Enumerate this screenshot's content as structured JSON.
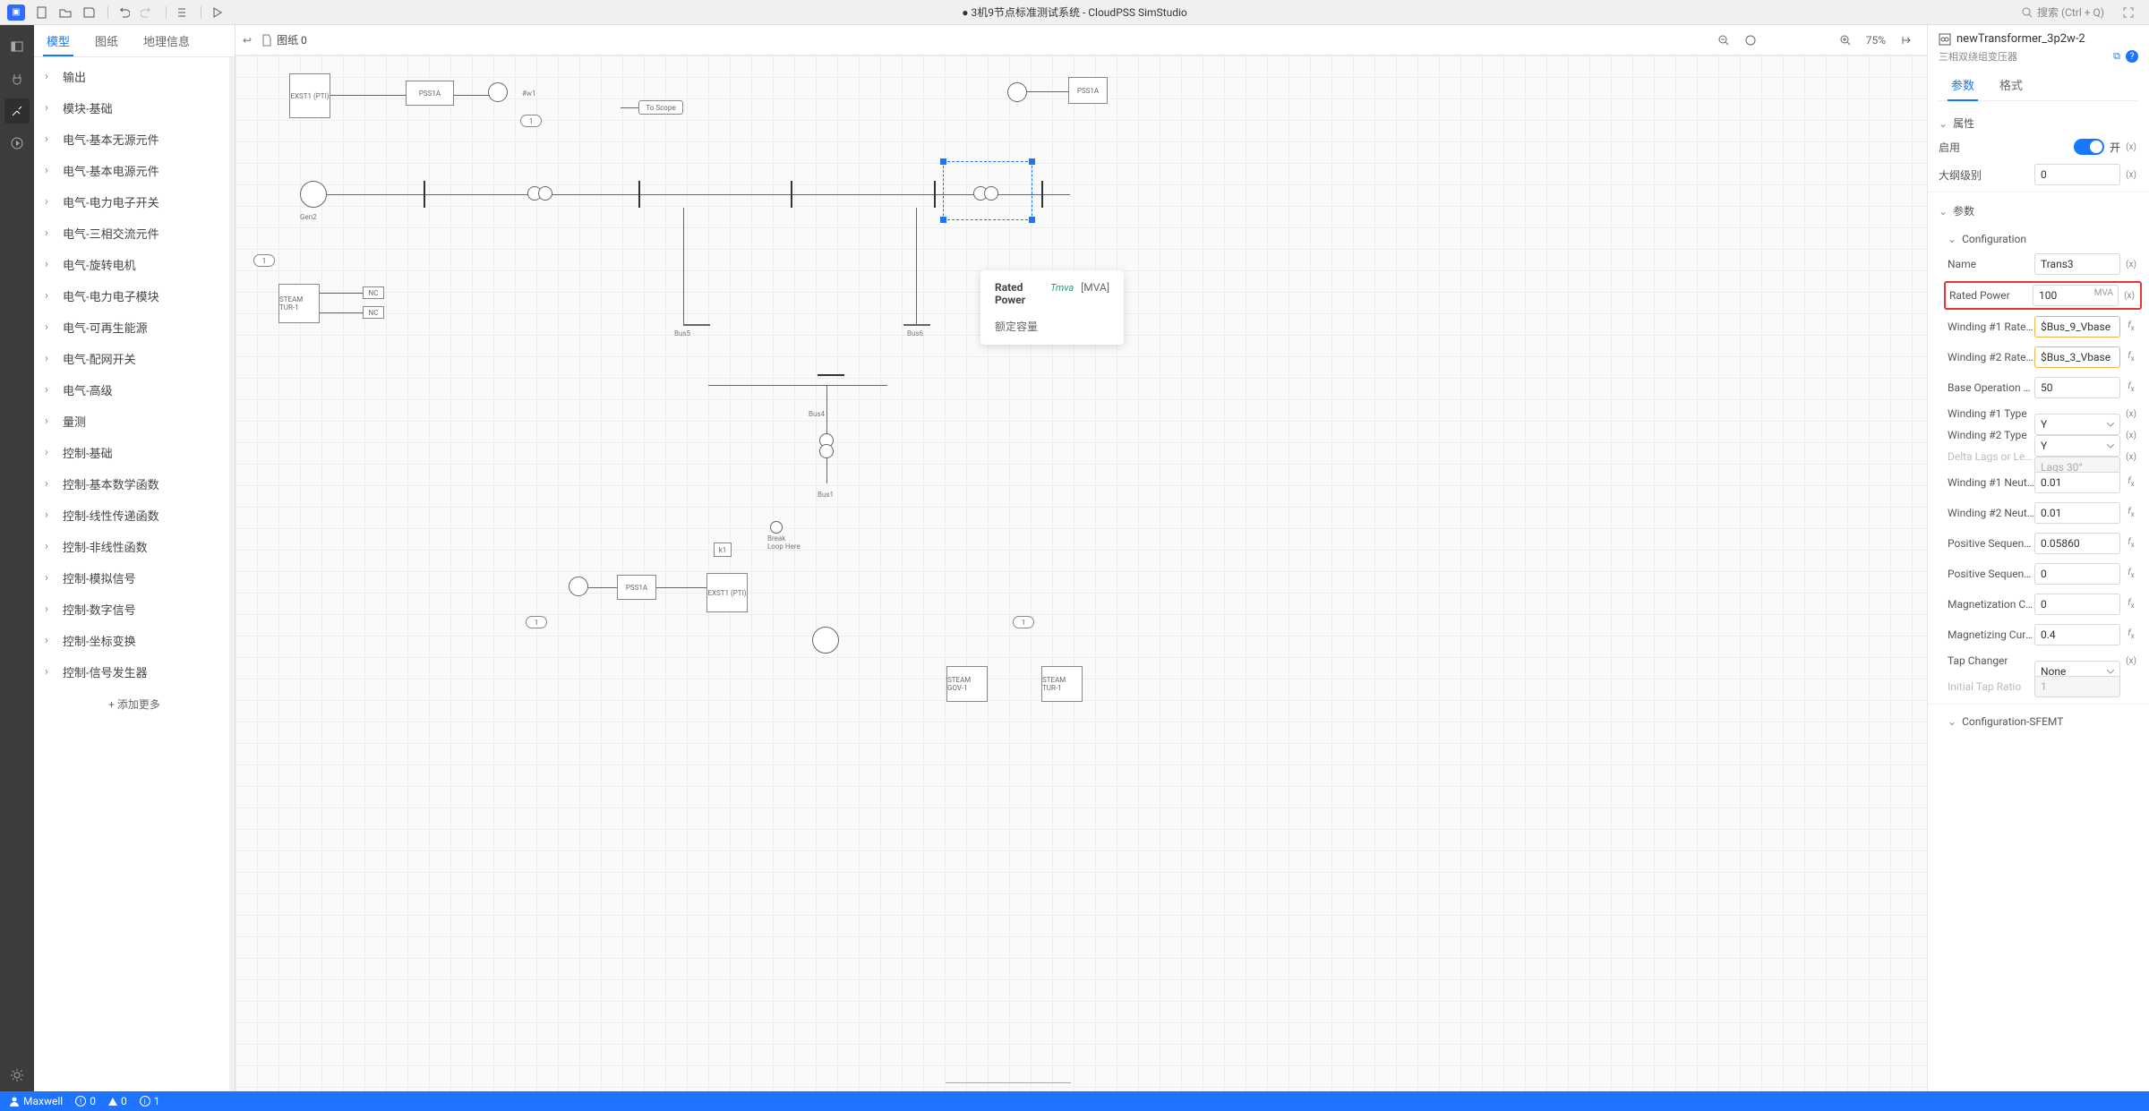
{
  "topbar": {
    "title": "● 3机9节点标准测试系统 - CloudPSS SimStudio",
    "search_placeholder": "搜索 (Ctrl + Q)"
  },
  "sidebar": {
    "tabs": [
      {
        "label": "模型",
        "active": true
      },
      {
        "label": "图纸",
        "active": false
      },
      {
        "label": "地理信息",
        "active": false
      }
    ],
    "tree": [
      "输出",
      "模块-基础",
      "电气-基本无源元件",
      "电气-基本电源元件",
      "电气-电力电子开关",
      "电气-三相交流元件",
      "电气-旋转电机",
      "电气-电力电子模块",
      "电气-可再生能源",
      "电气-配网开关",
      "电气-高级",
      "量测",
      "控制-基础",
      "控制-基本数学函数",
      "控制-线性传递函数",
      "控制-非线性函数",
      "控制-模拟信号",
      "控制-数字信号",
      "控制-坐标变换",
      "控制-信号发生器"
    ],
    "add_more": "添加更多"
  },
  "canvas": {
    "back_icon": "back",
    "file_label": "图纸 0",
    "zoom": "75%",
    "tooltip": {
      "name": "Rated Power",
      "sym": "Tmva",
      "unit": "[MVA]",
      "cn": "额定容量"
    },
    "labels": {
      "to_scope": "To Scope",
      "gen2": "Gen2",
      "pss1a": "PSS1A",
      "exst1": "EXST1\n(PTI)",
      "steam_gov": "STEAM\nGOV-1",
      "steam_tur": "STEAM\nTUR-1",
      "nc": "NC",
      "break_loop": "Break\nLoop Here",
      "k1": "k1"
    }
  },
  "rpanel": {
    "name": "newTransformer_3p2w-2",
    "subtitle": "三相双绕组变压器",
    "tabs": [
      {
        "label": "参数",
        "active": true
      },
      {
        "label": "格式",
        "active": false
      }
    ],
    "sec_attr": "属性",
    "attrs": {
      "enable_label": "启用",
      "enable_state": "开",
      "outline_label": "大纲级别",
      "outline_value": "0"
    },
    "sec_params": "参数",
    "sec_config": "Configuration",
    "config": [
      {
        "k": "Name",
        "v": "Trans3",
        "after": "(x)"
      },
      {
        "k": "Rated Power",
        "v": "100",
        "unit": "MVA",
        "after": "(x)",
        "hl": true
      },
      {
        "k": "Winding #1 Rated ...",
        "v": "$Bus_9_Vbase",
        "after": "fx",
        "fx": true
      },
      {
        "k": "Winding #2 Rated ...",
        "v": "$Bus_3_Vbase",
        "after": "fx",
        "fx": true
      },
      {
        "k": "Base Operation Fre...",
        "v": "50",
        "after": "fx"
      },
      {
        "k": "Winding #1 Type",
        "v": "Y",
        "after": "(x)",
        "select": true
      },
      {
        "k": "Winding #2 Type",
        "v": "Y",
        "after": "(x)",
        "select": true
      },
      {
        "k": "Delta Lags or Lead...",
        "v": "Lags 30°",
        "after": "(x)",
        "select": true,
        "disabled": true
      },
      {
        "k": "Winding #1 Neutral...",
        "v": "0.01",
        "after": "fx"
      },
      {
        "k": "Winding #2 Neutral...",
        "v": "0.01",
        "after": "fx"
      },
      {
        "k": "Positive Sequence ...",
        "v": "0.05860",
        "after": "fx"
      },
      {
        "k": "Positive Sequence ...",
        "v": "0",
        "after": "fx"
      },
      {
        "k": "Magnetization Con...",
        "v": "0",
        "after": "fx"
      },
      {
        "k": "Magnetizing Current",
        "v": "0.4",
        "after": "fx"
      },
      {
        "k": "Tap Changer",
        "v": "None",
        "after": "(x)",
        "select": true
      },
      {
        "k": "Initial Tap Ratio",
        "v": "1",
        "after": "",
        "disabled": true
      }
    ],
    "sec_config_sfemt": "Configuration-SFEMT"
  },
  "status": {
    "user": "Maxwell",
    "err": "0",
    "warn": "0",
    "info": "1"
  }
}
